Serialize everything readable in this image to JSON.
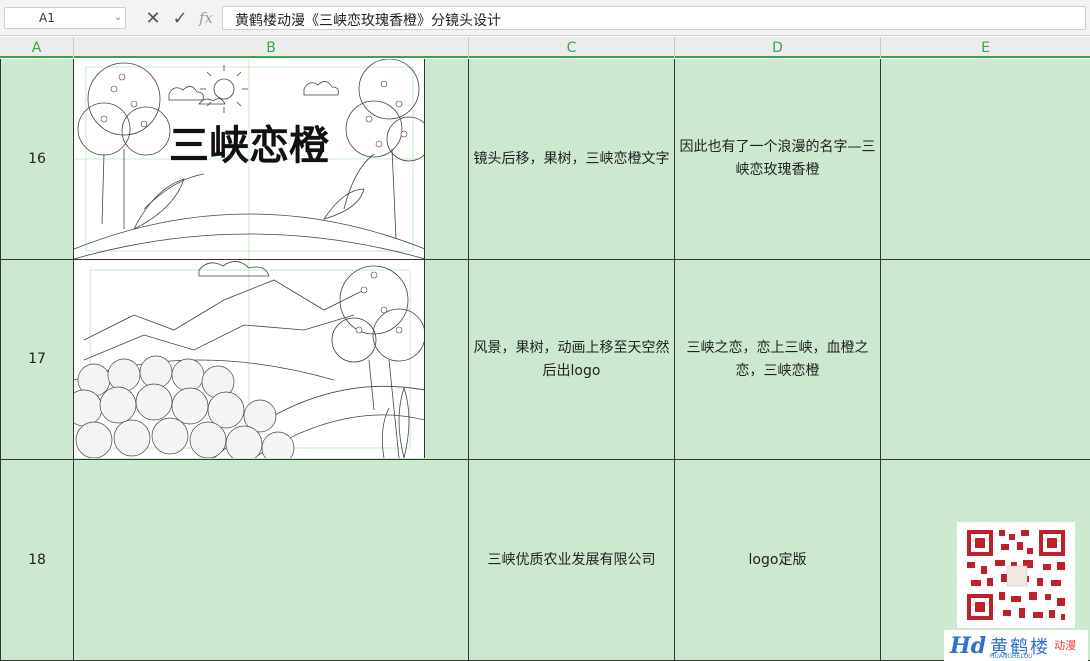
{
  "formula_bar": {
    "cell_ref": "A1",
    "formula_text": "黄鹤楼动漫《三峡恋玫瑰香橙》分镜头设计"
  },
  "columns": [
    "A",
    "B",
    "C",
    "D",
    "E"
  ],
  "rows": [
    {
      "number": "16",
      "art_title": "三峡恋橙",
      "c_text": "镜头后移，果树，三峡恋橙文字",
      "d_text": "因此也有了一个浪漫的名字—三峡恋玫瑰香橙",
      "e_text": ""
    },
    {
      "number": "17",
      "c_text": "风景，果树，动画上移至天空然后出logo",
      "d_text": "三峡之恋，恋上三峡，血橙之恋，三峡恋橙",
      "e_text": ""
    },
    {
      "number": "18",
      "c_text": "三峡优质农业发展有限公司",
      "d_text": "logo定版",
      "e_text": ""
    }
  ],
  "watermark": {
    "brand_mark": "Hd",
    "brand_name": "黄鹤楼",
    "brand_tag": "动漫",
    "brand_sub": "HUANGHELOU"
  },
  "colors": {
    "cell_fill": "#cce8cf",
    "header_accent": "#3aa447",
    "brand_blue": "#2f6fd6"
  }
}
